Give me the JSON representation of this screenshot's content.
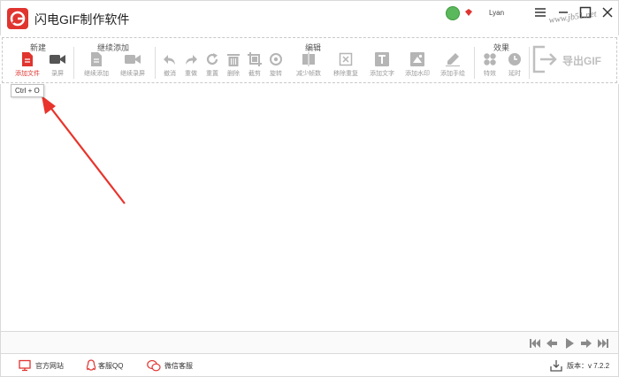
{
  "app": {
    "title": "闪电GIF制作软件",
    "username": "Lyan",
    "accent_color": "#e0342f"
  },
  "window_controls": [
    "menu-icon",
    "minimize-icon",
    "maximize-icon",
    "close-icon"
  ],
  "toolbar": {
    "groups": {
      "new": "新建",
      "continue_add": "继续添加",
      "edit": "编辑",
      "effects": "效果"
    },
    "tools": {
      "add_file": "添加文件",
      "record_screen": "录屏",
      "continue_add": "继续添加",
      "continue_record": "继续录屏",
      "undo": "撤消",
      "redo": "重做",
      "reset": "重置",
      "delete": "删除",
      "crop": "截剪",
      "rotate": "旋转",
      "reduce_frames": "减少帧数",
      "remove_duplicates": "移除重复",
      "add_text": "添加文字",
      "add_watermark": "添加水印",
      "add_handwriting": "添加手绘",
      "special_effects": "特效",
      "delay": "延时"
    },
    "export_label": "导出GIF"
  },
  "watermark_text": "www.jb51.net",
  "tooltip": "Ctrl + O",
  "footer": {
    "official_site": "官方网站",
    "support_qq": "客服QQ",
    "wechat_support": "微信客服",
    "version": "版本：v 7.2.2"
  }
}
